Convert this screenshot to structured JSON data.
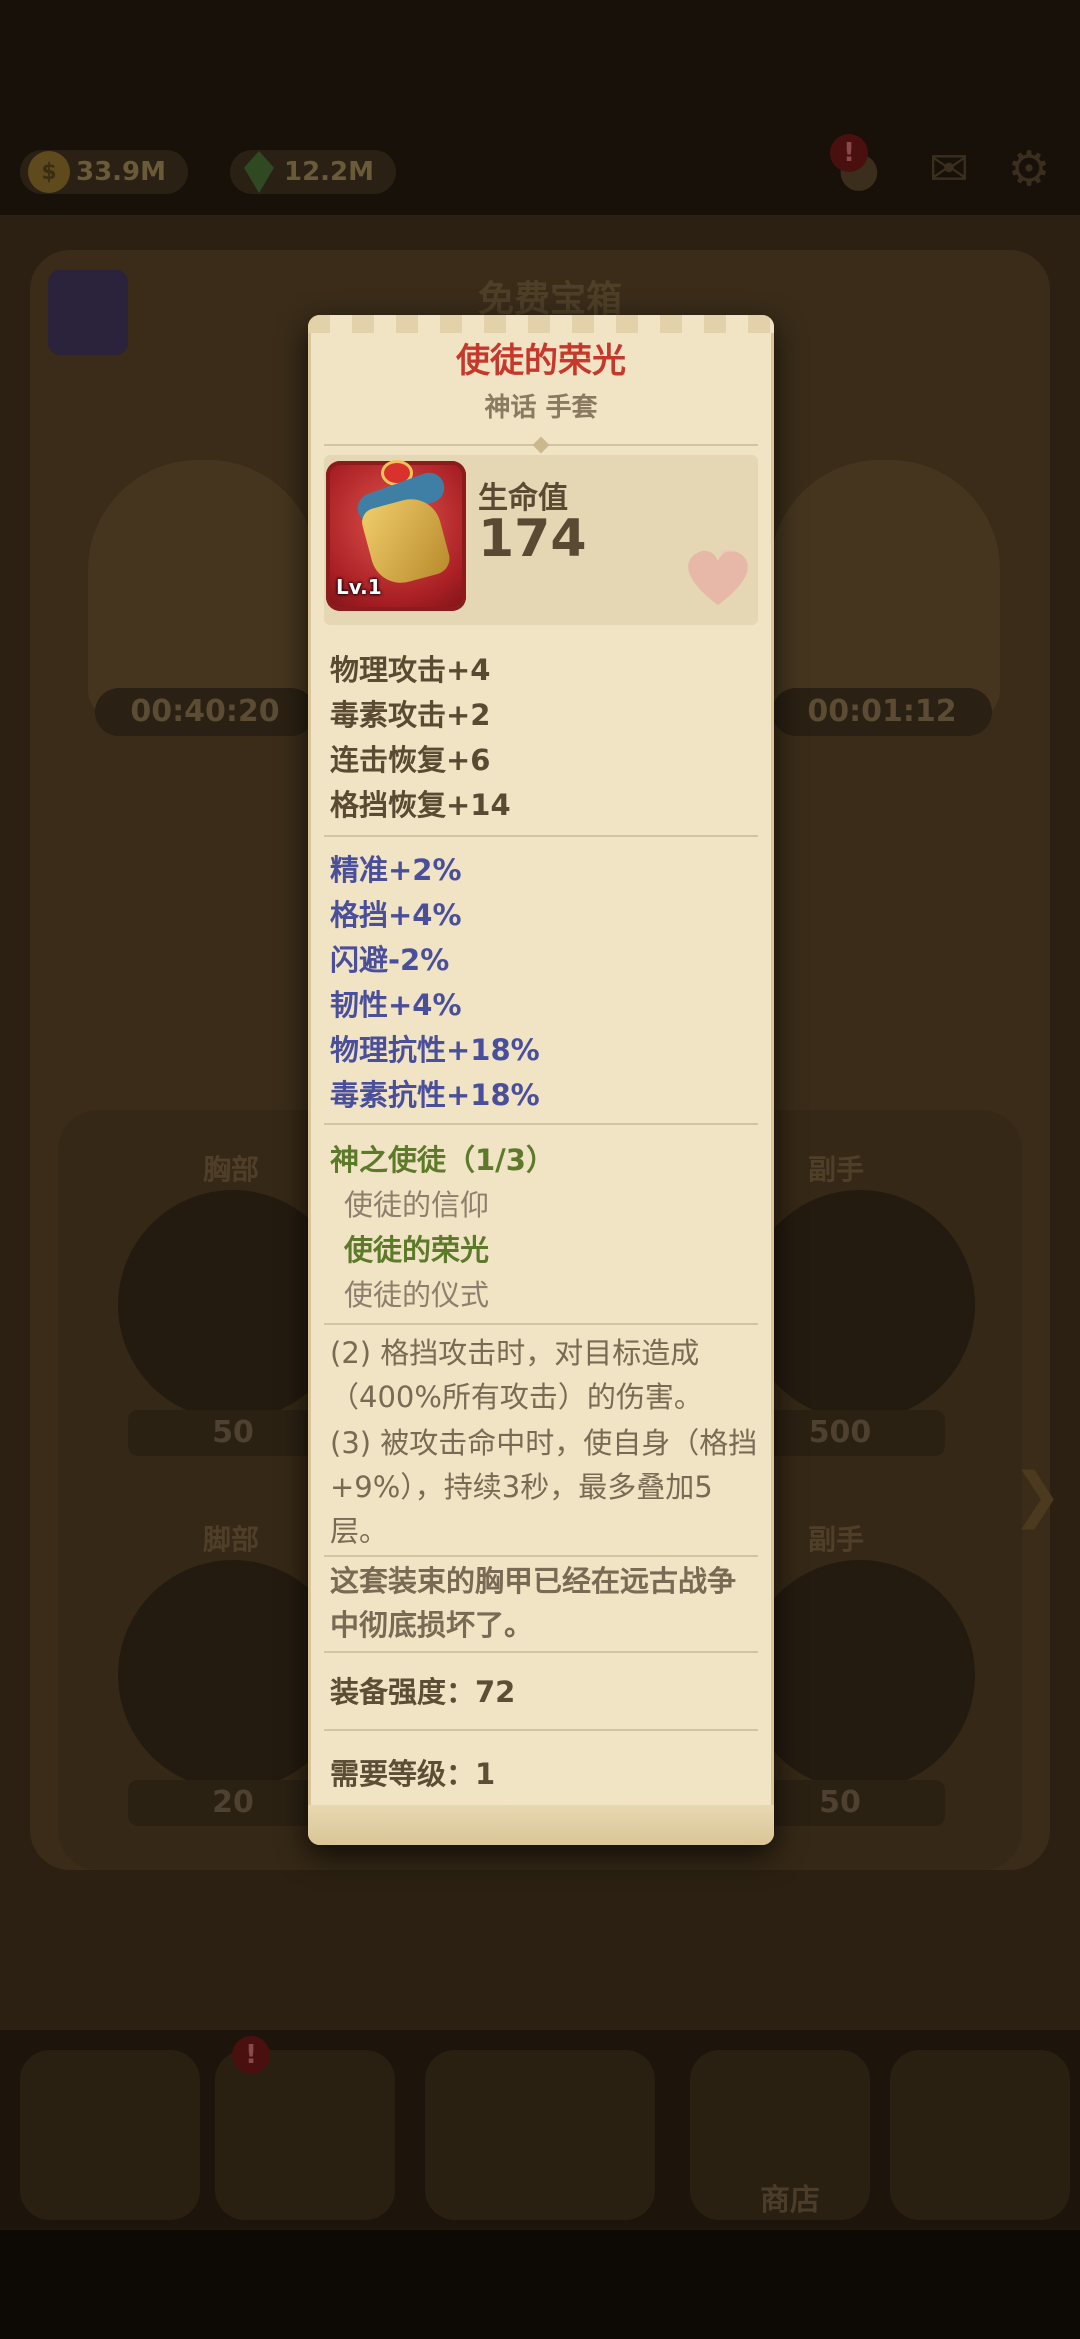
{
  "hud": {
    "gold": "33.9M",
    "gems": "12.2M",
    "alert": "!"
  },
  "background": {
    "free_chest_title": "免费宝箱",
    "chest_timers": [
      "00:40:20",
      "00:01:12"
    ],
    "slots": [
      {
        "label": "胸部",
        "cost": "50",
        "currency": "gold"
      },
      {
        "label": "副手",
        "cost": "500",
        "currency": "gold"
      },
      {
        "label": "脚部",
        "cost": "20",
        "currency": "gems"
      },
      {
        "label": "副手",
        "cost": "50",
        "currency": "gems"
      }
    ],
    "shop_label": "商店"
  },
  "item": {
    "name": "使徒的荣光",
    "subtitle": "神话 手套",
    "level": "Lv.1",
    "primary_stat_label": "生命值",
    "primary_stat_value": "174",
    "base_stats": [
      "物理攻击+4",
      "毒素攻击+2",
      "连击恢复+6",
      "格挡恢复+14"
    ],
    "bonus_stats": [
      "精准+2%",
      "格挡+4%",
      "闪避-2%",
      "韧性+4%",
      "物理抗性+18%",
      "毒素抗性+18%"
    ],
    "set": {
      "title": "神之使徒（1/3）",
      "pieces": [
        {
          "name": "使徒的信仰",
          "owned": false
        },
        {
          "name": "使徒的荣光",
          "owned": true
        },
        {
          "name": "使徒的仪式",
          "owned": false
        }
      ],
      "effects": [
        "(2) 格挡攻击时，对目标造成（400%所有攻击）的伤害。",
        "(3) 被攻击命中时，使自身（格挡+9%），持续3秒，最多叠加5层。"
      ]
    },
    "flavor": "这套装束的胸甲已经在远古战争中彻底损坏了。",
    "power": "装备强度：72",
    "required_level": "需要等级：1"
  }
}
